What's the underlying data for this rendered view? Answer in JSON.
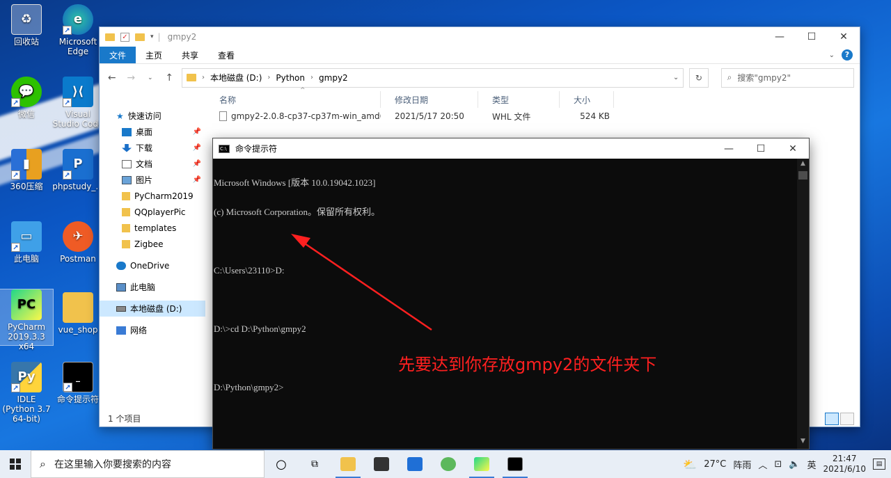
{
  "desktop": {
    "icons": [
      {
        "label": "回收站"
      },
      {
        "label": "Microsoft Edge"
      },
      {
        "label": "微信"
      },
      {
        "label": "Visual Studio Code"
      },
      {
        "label": "360压缩"
      },
      {
        "label": "phpstudy_..."
      },
      {
        "label": "此电脑"
      },
      {
        "label": "Postman"
      },
      {
        "label": "PyCharm 2019.3.3 x64"
      },
      {
        "label": "vue_shop"
      },
      {
        "label": "IDLE (Python 3.7 64-bit)"
      },
      {
        "label": "命令提示符"
      }
    ]
  },
  "explorer": {
    "title": "gmpy2",
    "tabs": [
      {
        "label": "文件"
      },
      {
        "label": "主页"
      },
      {
        "label": "共享"
      },
      {
        "label": "查看"
      }
    ],
    "address": {
      "parts": [
        "本地磁盘 (D:)",
        "Python",
        "gmpy2"
      ]
    },
    "search_placeholder": "搜索\"gmpy2\"",
    "nav": [
      {
        "label": "快速访问"
      },
      {
        "label": "桌面"
      },
      {
        "label": "下载"
      },
      {
        "label": "文档"
      },
      {
        "label": "图片"
      },
      {
        "label": "PyCharm2019"
      },
      {
        "label": "QQplayerPic"
      },
      {
        "label": "templates"
      },
      {
        "label": "Zigbee"
      },
      {
        "label": "OneDrive"
      },
      {
        "label": "此电脑"
      },
      {
        "label": "本地磁盘 (D:)"
      },
      {
        "label": "网络"
      }
    ],
    "columns": {
      "name": "名称",
      "modified": "修改日期",
      "type": "类型",
      "size": "大小"
    },
    "files": [
      {
        "name": "gmpy2-2.0.8-cp37-cp37m-win_amd6...",
        "modified": "2021/5/17 20:50",
        "type": "WHL 文件",
        "size": "524 KB"
      }
    ],
    "status": "1 个项目"
  },
  "cmd": {
    "title": "命令提示符",
    "lines": [
      "Microsoft Windows [版本 10.0.19042.1023]",
      "(c) Microsoft Corporation。保留所有权利。",
      "",
      "C:\\Users\\23110>D:",
      "",
      "D:\\>cd D:\\Python\\gmpy2",
      "",
      "D:\\Python\\gmpy2>"
    ]
  },
  "annotation": {
    "text": "先要达到你存放gmpy2的文件夹下",
    "color": "#ff2020"
  },
  "taskbar": {
    "search_placeholder": "在这里输入你要搜索的内容",
    "weather_temp": "27°C",
    "weather_text": "阵雨",
    "ime": "英",
    "time": "21:47",
    "date": "2021/6/10"
  }
}
